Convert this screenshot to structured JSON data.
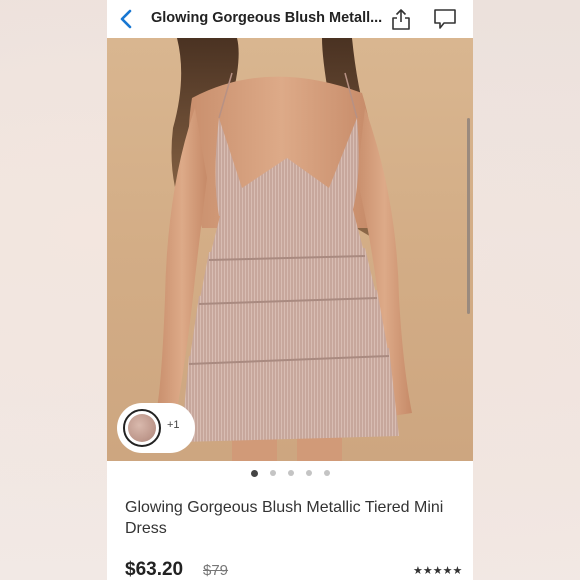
{
  "nav": {
    "title": "Glowing Gorgeous Blush Metall...",
    "back_icon": "chevron-left-icon",
    "share_icon": "share-icon",
    "comment_icon": "comment-icon"
  },
  "gallery": {
    "image_alt": "Glowing Gorgeous Blush Metallic Tiered Mini Dress",
    "swatch_more": "+1",
    "dots_count": 5,
    "active_dot": 0
  },
  "product": {
    "title": "Glowing Gorgeous Blush Metallic Tiered Mini Dress",
    "price": "$63.20",
    "original_price": "$79",
    "rating_stars": "★★★★★",
    "rating_value": 5
  },
  "colors": {
    "accent": "#1877d2",
    "photo_background": "#d6b08a",
    "dress": "#c9a79b"
  }
}
